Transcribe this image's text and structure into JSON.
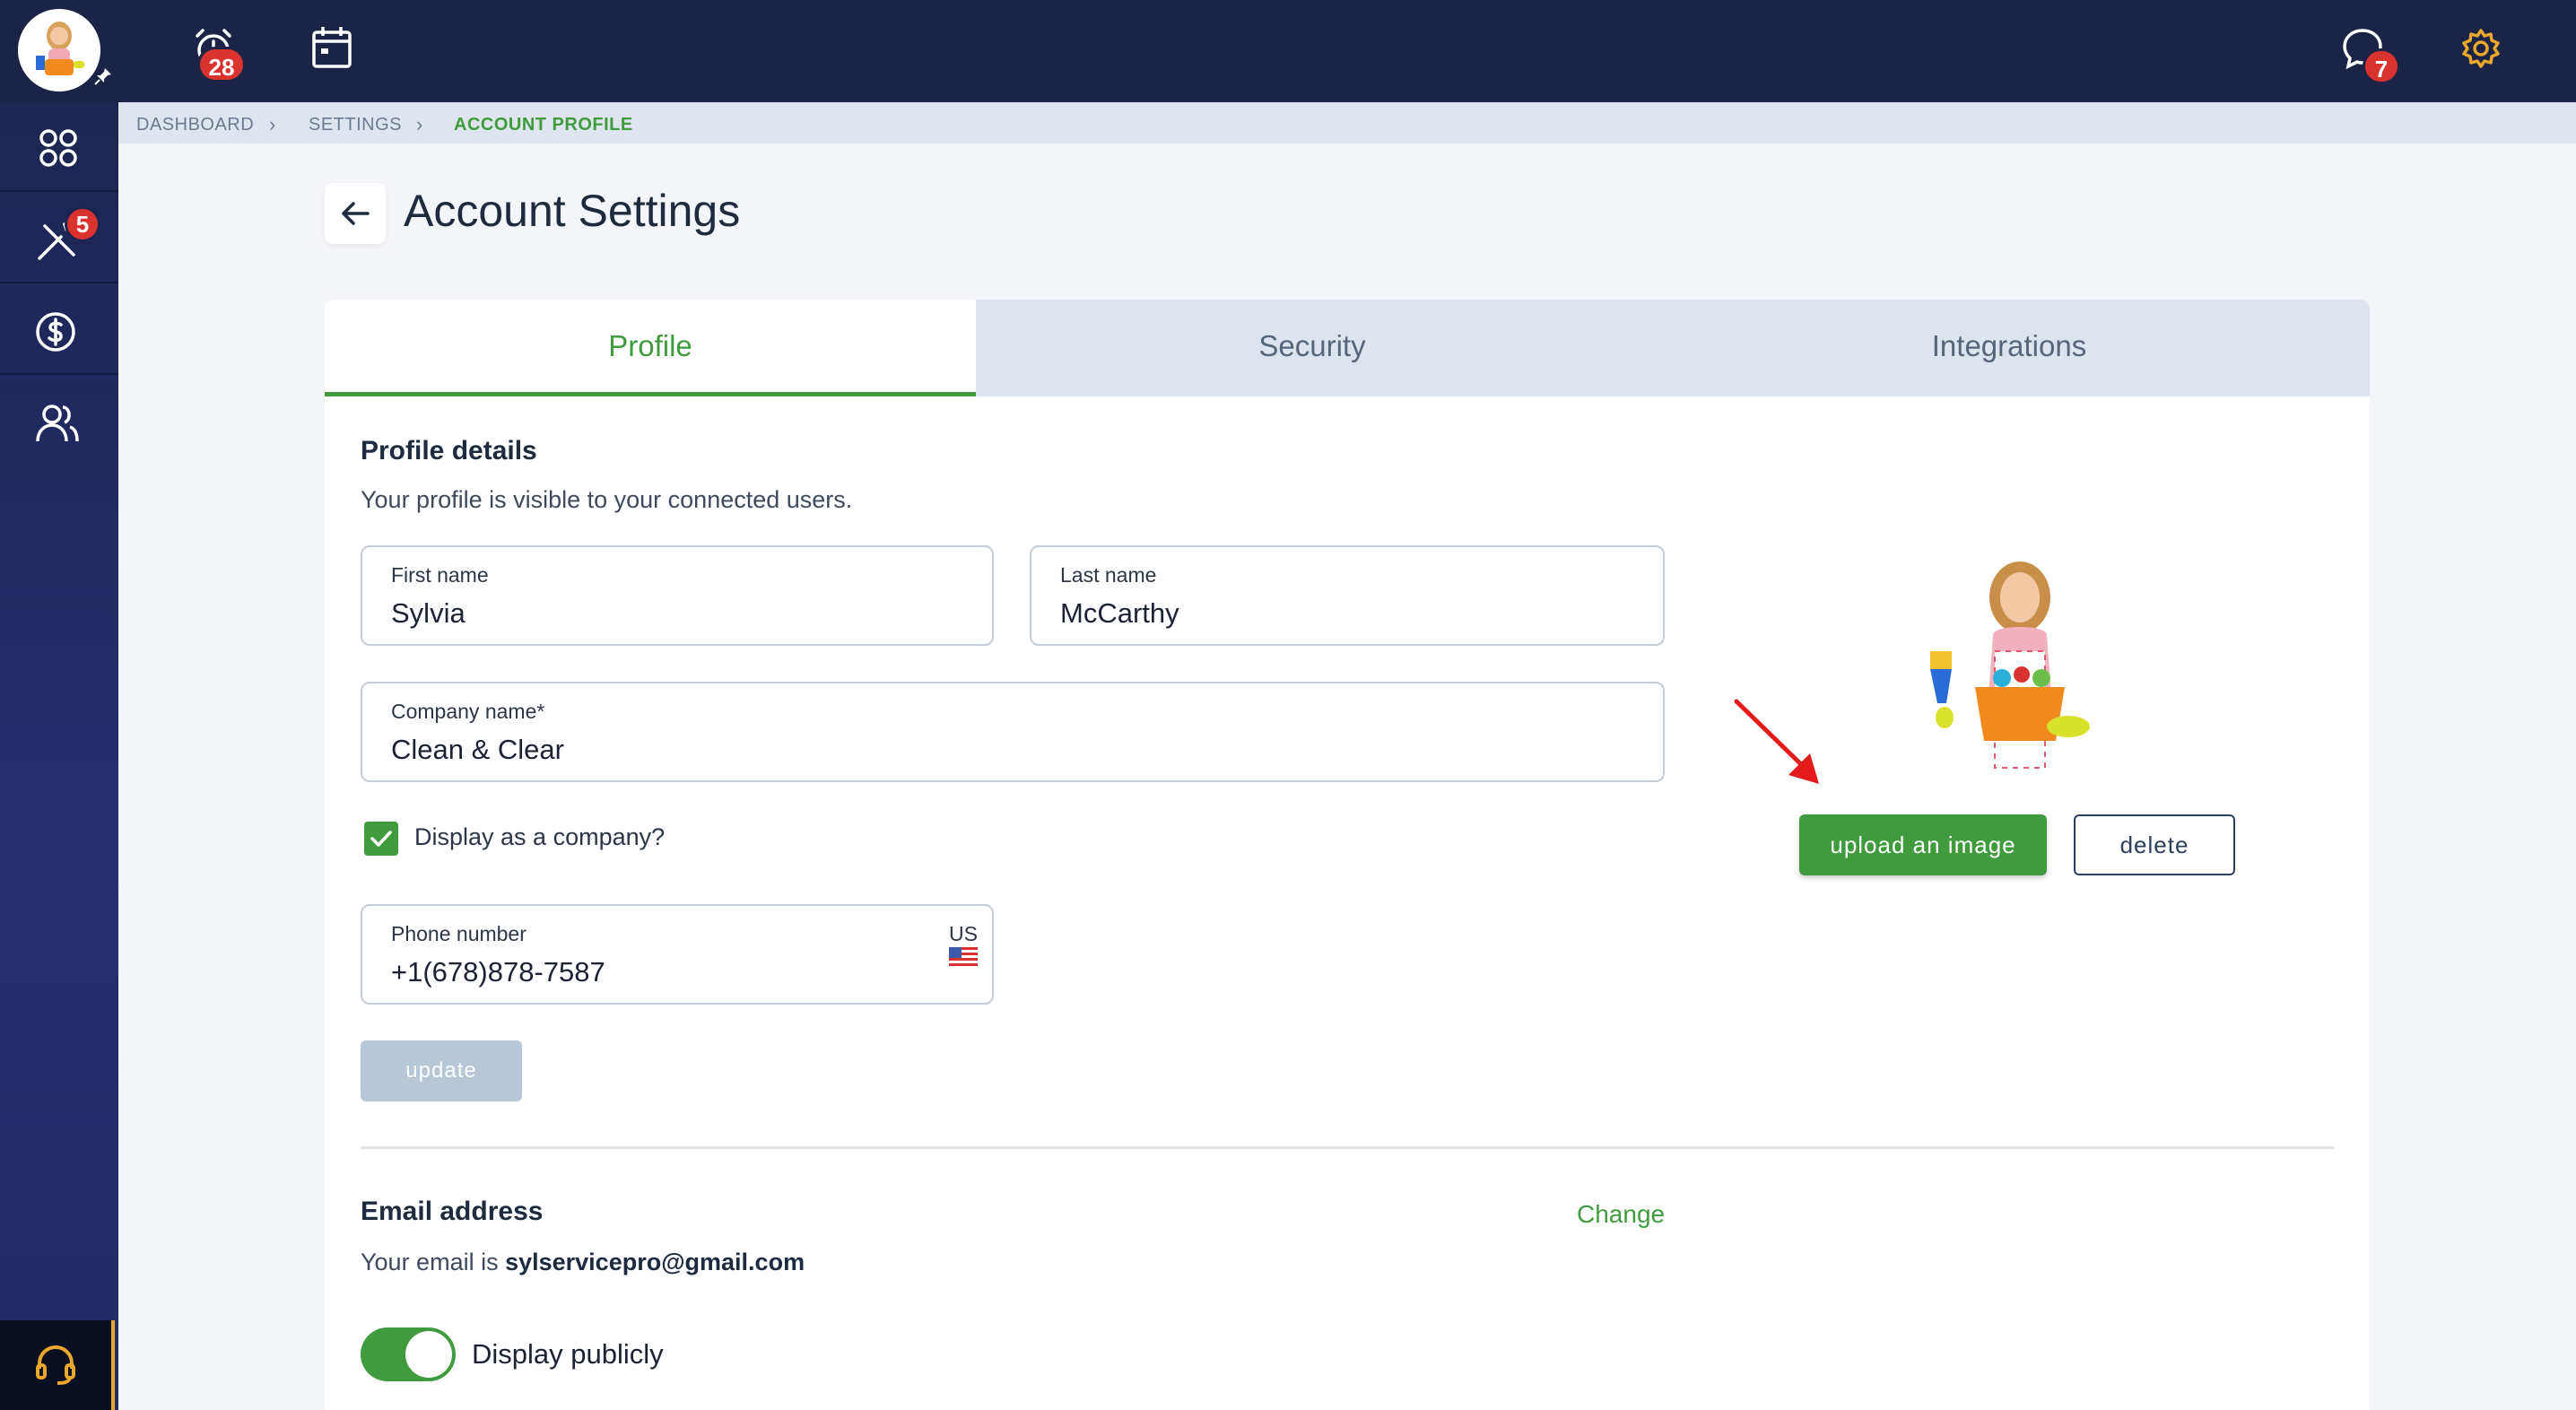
{
  "topbar": {
    "reminders_badge": "28",
    "messages_badge": "7"
  },
  "sidebar": {
    "tools_badge": "5"
  },
  "breadcrumb": {
    "items": [
      "DASHBOARD",
      "SETTINGS",
      "ACCOUNT PROFILE"
    ]
  },
  "page": {
    "title": "Account Settings"
  },
  "tabs": [
    {
      "label": "Profile",
      "active": true
    },
    {
      "label": "Security",
      "active": false
    },
    {
      "label": "Integrations",
      "active": false
    }
  ],
  "profile": {
    "section_title": "Profile details",
    "subtitle": "Your profile is visible to your connected users.",
    "first_name": {
      "label": "First name",
      "value": "Sylvia"
    },
    "last_name": {
      "label": "Last name",
      "value": "McCarthy"
    },
    "company": {
      "label": "Company name*",
      "value": "Clean & Clear"
    },
    "display_company": {
      "label": "Display as a company?",
      "checked": true
    },
    "phone": {
      "label": "Phone number",
      "value": "+1(678)878-7587",
      "country": "US"
    },
    "update_label": "update",
    "upload_label": "upload an image",
    "delete_label": "delete"
  },
  "email": {
    "section_title": "Email address",
    "change_label": "Change",
    "prefix": "Your email is",
    "address": "sylservicepro@gmail.com",
    "display_publicly_label": "Display publicly",
    "display_publicly": true
  },
  "colors": {
    "accent": "#3f9b3e",
    "nav": "#1b2347",
    "badge": "#d9322f",
    "gear": "#e9a72c"
  }
}
